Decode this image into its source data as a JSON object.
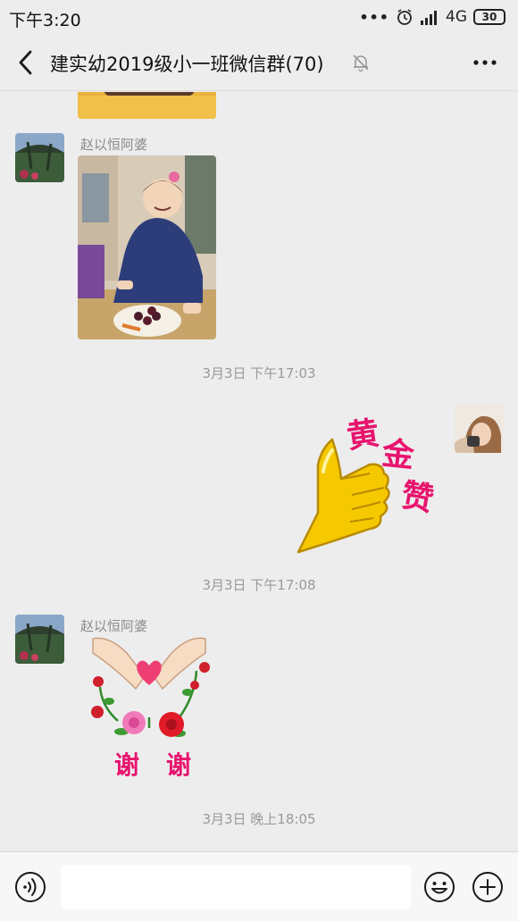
{
  "status_bar": {
    "time": "下午3:20",
    "dots": "•••",
    "network": "4G",
    "battery": "30"
  },
  "header": {
    "title": "建实幼2019级小一班微信群(70)",
    "icons": [
      "back-icon",
      "mute-bell-icon",
      "more-icon"
    ]
  },
  "messages": [
    {
      "type": "image",
      "side": "left",
      "sender": "",
      "description_icon": "photo"
    },
    {
      "type": "image",
      "side": "left",
      "sender": "赵以恒阿婆"
    },
    {
      "type": "timestamp",
      "text": "3月3日 下午17:03"
    },
    {
      "type": "sticker",
      "side": "right",
      "sticker_text": [
        "黄",
        "金",
        "赞"
      ]
    },
    {
      "type": "timestamp",
      "text": "3月3日 下午17:08"
    },
    {
      "type": "sticker",
      "side": "left",
      "sender": "赵以恒阿婆",
      "sticker_text": [
        "谢",
        "谢"
      ]
    },
    {
      "type": "timestamp",
      "text": "3月3日 晚上18:05"
    }
  ],
  "input_bar": {
    "value": "",
    "placeholder": "",
    "icons": [
      "voice-icon",
      "emoji-icon",
      "plus-icon"
    ]
  },
  "colors": {
    "background": "#ededed",
    "sticker_text": "#e8146e",
    "thumb": "#f5c400"
  }
}
